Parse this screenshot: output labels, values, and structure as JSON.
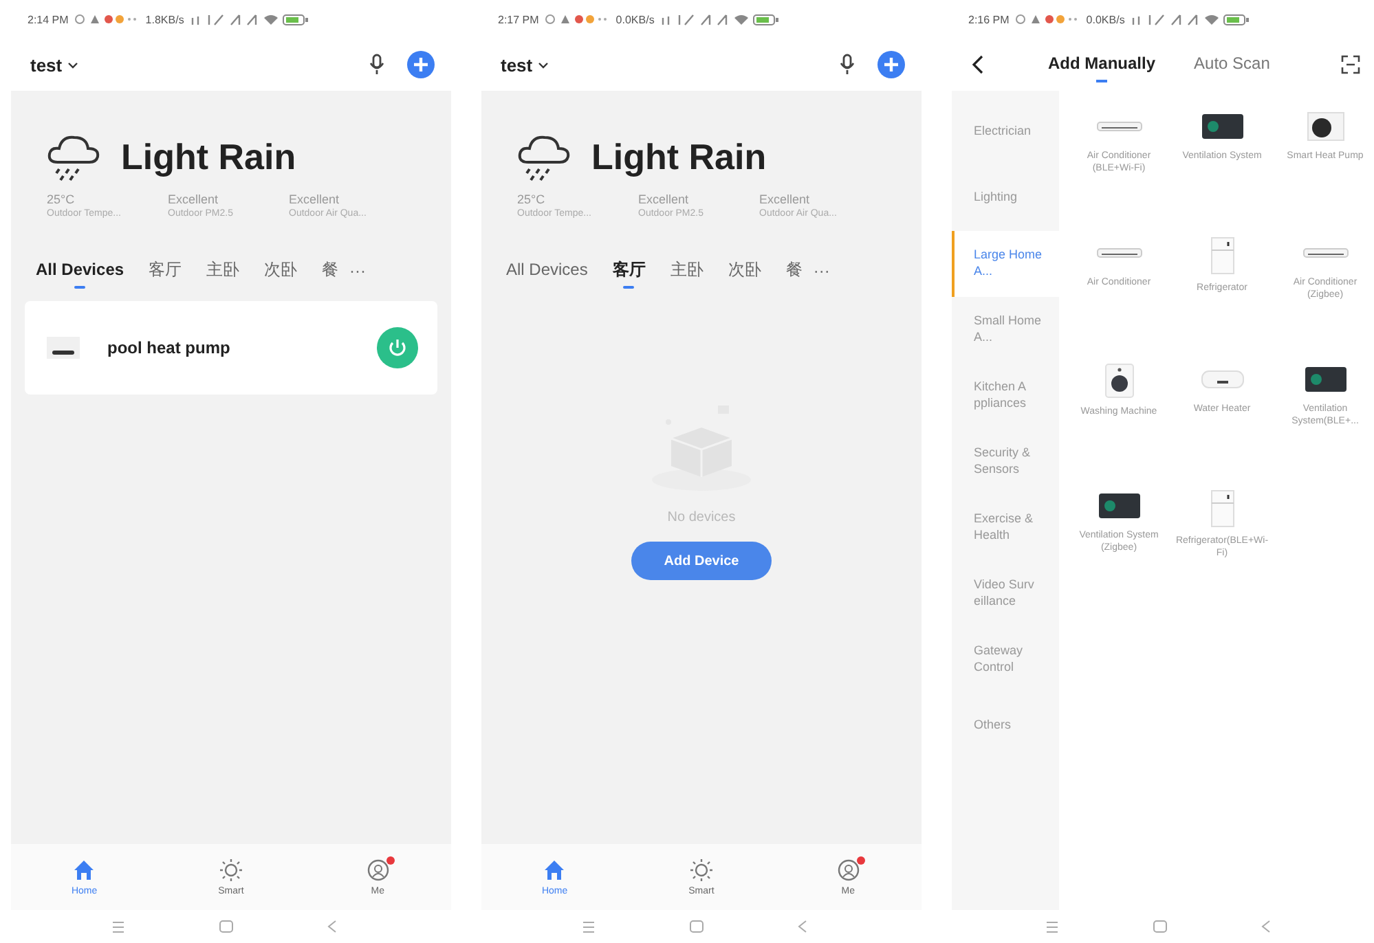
{
  "screens": [
    {
      "kind": "home",
      "status_bar": {
        "time": "2:14 PM",
        "speed": "1.8KB/s"
      },
      "home_name": "test",
      "weather": {
        "condition": "Light Rain",
        "stats": [
          {
            "value": "25°C",
            "label": "Outdoor Tempe..."
          },
          {
            "value": "Excellent",
            "label": "Outdoor PM2.5"
          },
          {
            "value": "Excellent",
            "label": "Outdoor Air Qua..."
          }
        ]
      },
      "tabs": [
        {
          "label": "All Devices",
          "selected": true
        },
        {
          "label": "客厅",
          "selected": false
        },
        {
          "label": "主卧",
          "selected": false
        },
        {
          "label": "次卧",
          "selected": false
        },
        {
          "label": "餐",
          "selected": false
        }
      ],
      "more": "···",
      "devices": [
        {
          "name": "pool heat pump",
          "on": true
        }
      ],
      "nav": [
        {
          "label": "Home",
          "selected": true,
          "badge": false
        },
        {
          "label": "Smart",
          "selected": false,
          "badge": false
        },
        {
          "label": "Me",
          "selected": false,
          "badge": true
        }
      ]
    },
    {
      "kind": "home",
      "status_bar": {
        "time": "2:17 PM",
        "speed": "0.0KB/s"
      },
      "home_name": "test",
      "weather": {
        "condition": "Light Rain",
        "stats": [
          {
            "value": "25°C",
            "label": "Outdoor Tempe..."
          },
          {
            "value": "Excellent",
            "label": "Outdoor PM2.5"
          },
          {
            "value": "Excellent",
            "label": "Outdoor Air Qua..."
          }
        ]
      },
      "tabs": [
        {
          "label": "All Devices",
          "selected": false
        },
        {
          "label": "客厅",
          "selected": true
        },
        {
          "label": "主卧",
          "selected": false
        },
        {
          "label": "次卧",
          "selected": false
        },
        {
          "label": "餐",
          "selected": false
        }
      ],
      "more": "···",
      "empty_text": "No devices",
      "add_button": "Add Device",
      "nav": [
        {
          "label": "Home",
          "selected": true,
          "badge": false
        },
        {
          "label": "Smart",
          "selected": false,
          "badge": false
        },
        {
          "label": "Me",
          "selected": false,
          "badge": true
        }
      ]
    },
    {
      "kind": "add",
      "status_bar": {
        "time": "2:16 PM",
        "speed": "0.0KB/s"
      },
      "tabs": [
        {
          "label": "Add Manually",
          "selected": true
        },
        {
          "label": "Auto Scan",
          "selected": false
        }
      ],
      "categories": [
        {
          "label": "Electrician",
          "selected": false
        },
        {
          "label": "Lighting",
          "selected": false
        },
        {
          "label": "Large Home A...",
          "selected": true
        },
        {
          "label": "Small Home A...",
          "selected": false
        },
        {
          "label": "Kitchen A ppliances",
          "selected": false
        },
        {
          "label": "Security & Sensors",
          "selected": false
        },
        {
          "label": "Exercise & Health",
          "selected": false
        },
        {
          "label": "Video Surv eillance",
          "selected": false
        },
        {
          "label": "Gateway Control",
          "selected": false
        },
        {
          "label": "Others",
          "selected": false
        }
      ],
      "products": [
        {
          "name": "Air Conditioner (BLE+Wi-Fi)",
          "kind": "ac"
        },
        {
          "name": "Ventilation System",
          "kind": "vent"
        },
        {
          "name": "Smart Heat Pump",
          "kind": "heatpump"
        },
        {
          "name": "Air Conditioner",
          "kind": "ac"
        },
        {
          "name": "Refrigerator",
          "kind": "fridge"
        },
        {
          "name": "Air Conditioner (Zigbee)",
          "kind": "ac"
        },
        {
          "name": "Washing Machine",
          "kind": "washer"
        },
        {
          "name": "Water Heater",
          "kind": "heater"
        },
        {
          "name": "Ventilation System(BLE+...",
          "kind": "vent"
        },
        {
          "name": "Ventilation System (Zigbee)",
          "kind": "vent"
        },
        {
          "name": "Refrigerator(BLE+Wi-Fi)",
          "kind": "fridge"
        }
      ]
    }
  ]
}
